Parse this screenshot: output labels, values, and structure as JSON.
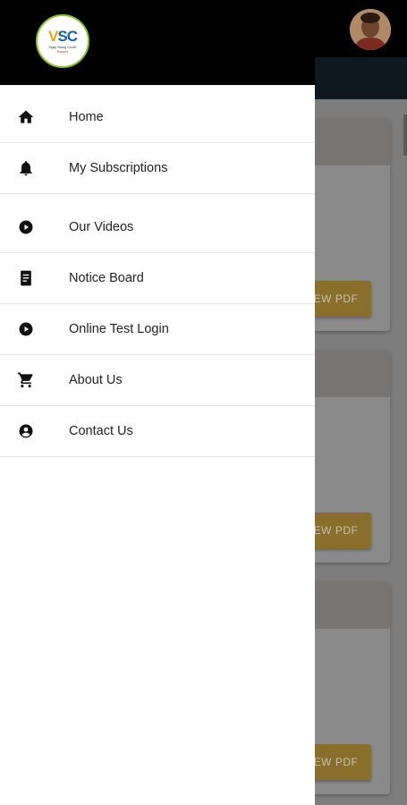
{
  "app": {
    "logo_letters": "VSC",
    "logo_subtitle": "Vijay Study Circle",
    "logo_city": "Ranchi"
  },
  "menu": {
    "items": [
      {
        "label": "Home",
        "icon": "home-icon"
      },
      {
        "label": "My Subscriptions",
        "icon": "bell-icon"
      },
      {
        "label": "Our Videos",
        "icon": "play-circle-icon"
      },
      {
        "label": "Notice Board",
        "icon": "document-icon"
      },
      {
        "label": "Online Test Login",
        "icon": "play-circle-icon"
      },
      {
        "label": "About Us",
        "icon": "cart-icon"
      },
      {
        "label": "Contact Us",
        "icon": "account-circle-icon"
      }
    ]
  },
  "cards": [
    {
      "button_label": "EW PDF"
    },
    {
      "button_label": "EW PDF"
    },
    {
      "button_label": "EW PDF"
    }
  ],
  "colors": {
    "appbar": "#000000",
    "accent_button": "#e0a91c",
    "drawer": "#ffffff"
  }
}
